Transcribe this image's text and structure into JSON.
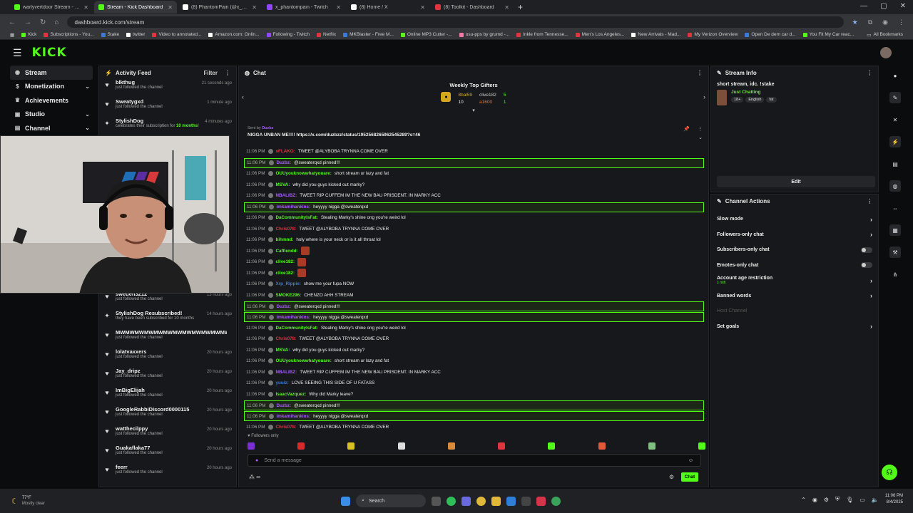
{
  "browser": {
    "tabs": [
      {
        "title": "warlyvertdoor Stream - Watch",
        "color": "#53fc18",
        "active": false
      },
      {
        "title": "Stream - Kick Dashboard",
        "color": "#53fc18",
        "active": true
      },
      {
        "title": "(8) PhantomPain (@x_Phantom...",
        "color": "#ffffff",
        "active": false
      },
      {
        "title": "x_phantompain - Twitch",
        "color": "#9146ff",
        "active": false
      },
      {
        "title": "(8) Home / X",
        "color": "#ffffff",
        "active": false
      },
      {
        "title": "(8) Toolkit - Dashboard",
        "color": "#e0343e",
        "active": false
      }
    ],
    "url": "dashboard.kick.com/stream",
    "bookmarks": [
      {
        "label": "Kick",
        "color": "#53fc18"
      },
      {
        "label": "Subscriptions - You...",
        "color": "#e0343e"
      },
      {
        "label": "Stake",
        "color": "#3a7bd5"
      },
      {
        "label": "twitter",
        "color": "#ffffff"
      },
      {
        "label": "Video to annotated...",
        "color": "#e0343e"
      },
      {
        "label": "Amazon.com: Onlin...",
        "color": "#ffffff"
      },
      {
        "label": "Following - Twitch",
        "color": "#9146ff"
      },
      {
        "label": "Netflix",
        "color": "#e0343e"
      },
      {
        "label": "MKBlaster - Free M...",
        "color": "#3a7bd5"
      },
      {
        "label": "Online MP3 Cutter -...",
        "color": "#53fc18"
      },
      {
        "label": "osu-pps by grumd -...",
        "color": "#f07aa5"
      },
      {
        "label": "Inkle from Tennesse...",
        "color": "#e0343e"
      },
      {
        "label": "Men's Los Angeles...",
        "color": "#e0343e"
      },
      {
        "label": "New Arrivals - Mad...",
        "color": "#ffffff"
      },
      {
        "label": "My Verizon Overview",
        "color": "#e0343e"
      },
      {
        "label": "Open De dem car d...",
        "color": "#3a7bd5"
      },
      {
        "label": "You Fit My Car reac...",
        "color": "#53fc18"
      }
    ],
    "all_bookmarks": "All Bookmarks"
  },
  "kick": {
    "logo": "KICK"
  },
  "nav": {
    "items": [
      {
        "label": "Stream",
        "icon": "stream-icon",
        "selected": true,
        "chevron": false
      },
      {
        "label": "Monetization",
        "icon": "dollar-icon",
        "selected": false,
        "chevron": true
      },
      {
        "label": "Achievements",
        "icon": "trophy-icon",
        "selected": false,
        "chevron": false
      },
      {
        "label": "Studio",
        "icon": "studio-icon",
        "selected": false,
        "chevron": true
      },
      {
        "label": "Channel",
        "icon": "channel-icon",
        "selected": false,
        "chevron": true
      }
    ]
  },
  "activity": {
    "title": "Activity Feed",
    "filter": "Filter",
    "items": [
      {
        "name": "blkthug",
        "sub": "just followed the channel",
        "time": "21 seconds ago",
        "icon": "heart"
      },
      {
        "name": "Sweatygxd",
        "sub": "just followed the channel",
        "time": "1 minute ago",
        "icon": "heart"
      },
      {
        "name": "StylishDog",
        "sub_pre": "celebrates their subscription for ",
        "sub_hl": "10 months",
        "sub_post": "!",
        "time": "4 minutes ago",
        "icon": "star"
      },
      {
        "name": "",
        "sub": "",
        "time": "",
        "icon": "none"
      },
      {
        "name": "",
        "sub": "",
        "time": "",
        "icon": "none"
      },
      {
        "name": "",
        "sub": "",
        "time": "",
        "icon": "none"
      },
      {
        "name": "",
        "sub": "",
        "time": "",
        "icon": "none"
      },
      {
        "name": "",
        "sub": "",
        "time": "",
        "icon": "none"
      },
      {
        "name": "",
        "sub": "",
        "time": "",
        "icon": "none"
      },
      {
        "name": "",
        "sub": "",
        "time": "",
        "icon": "none"
      },
      {
        "name": "",
        "sub": "",
        "time": "",
        "icon": "none"
      },
      {
        "name": "sweden3212",
        "sub": "just followed the channel",
        "time": "13 hours ago",
        "icon": "heart"
      },
      {
        "name": "StylishDog Resubscribed!",
        "sub": "they have been subscribed for 10 months",
        "time": "14 hours ago",
        "icon": "star"
      },
      {
        "name": "MWMWMWMWMWMWMWMWMWMWMWMW",
        "sub": "just followed the channel",
        "time": "",
        "icon": "heart"
      },
      {
        "name": "lolatvaxxers",
        "sub": "just followed the channel",
        "time": "20 hours ago",
        "icon": "heart"
      },
      {
        "name": "Jay_dripz",
        "sub": "just followed the channel",
        "time": "20 hours ago",
        "icon": "heart"
      },
      {
        "name": "ImBigElijah",
        "sub": "just followed the channel",
        "time": "20 hours ago",
        "icon": "heart"
      },
      {
        "name": "GoogleRabbiDiscord0000115",
        "sub": "just followed the channel",
        "time": "20 hours ago",
        "icon": "heart"
      },
      {
        "name": "watthecilppy",
        "sub": "just followed the channel",
        "time": "20 hours ago",
        "icon": "heart"
      },
      {
        "name": "Guakaflaka77",
        "sub": "just followed the channel",
        "time": "20 hours ago",
        "icon": "heart"
      },
      {
        "name": "feerr",
        "sub": "just followed the channel",
        "time": "20 hours ago",
        "icon": "heart"
      }
    ]
  },
  "chat": {
    "title": "Chat",
    "gifters_title": "Weekly Top Gifters",
    "gifters": [
      {
        "name": "8bal59",
        "count": "10",
        "name_color": "#d7a621"
      },
      {
        "name": "clive182",
        "count": "5",
        "name_color": "#cccccc"
      },
      {
        "name": "a1600",
        "count": "1",
        "name_color": "#e07a3a"
      }
    ],
    "pinned_by_pre": "Sent by ",
    "pinned_by_user": "Duzbz",
    "pinned_msg": "NIGGA UNBAN ME!!!! https://x.com/duzbzz/status/1952568265962545289?s=46",
    "lines": [
      {
        "time": "11:06 PM",
        "user": "xFLAKO",
        "ucolor": "#e0343e",
        "msg": "TWEET @ALYBOBA TRYNNA COME OVER",
        "hl": false
      },
      {
        "time": "11:06 PM",
        "user": "Duzbz",
        "ucolor": "#a85bff",
        "msg": "@sweaterqxd pinned!!!",
        "hl": true
      },
      {
        "time": "11:06 PM",
        "user": "OUUyouknowwhatyouare",
        "ucolor": "#53fc18",
        "msg": "short stream ur lazy and fat",
        "hl": false
      },
      {
        "time": "11:06 PM",
        "user": "MSVA",
        "ucolor": "#53fc18",
        "msg": "why did you guys kicked out marky?",
        "hl": false
      },
      {
        "time": "11:06 PM",
        "user": "NBALIBZ",
        "ucolor": "#a85bff",
        "msg": "TWEET RIP CUFFEM IM THE NEW BAU PRISDENT. IN MARKY ACC",
        "hl": false
      },
      {
        "time": "11:06 PM",
        "user": "imkamihankins",
        "ucolor": "#a85bff",
        "msg": "heyyyy nigga @sweaterqxd",
        "hl": true
      },
      {
        "time": "11:06 PM",
        "user": "DaCommunityIsFat",
        "ucolor": "#53fc18",
        "msg": "Stealing Marky's shine ong you're weird lol",
        "hl": false
      },
      {
        "time": "11:06 PM",
        "user": "Chris078",
        "ucolor": "#e0343e",
        "msg": "TWEET @ALYBOBA TRYNNA COME OVER",
        "hl": false
      },
      {
        "time": "11:06 PM",
        "user": "bihmnd",
        "ucolor": "#53fc18",
        "msg": "holy where is your neck or is it all throat lol",
        "hl": false
      },
      {
        "time": "11:06 PM",
        "user": "Caffiendd",
        "ucolor": "#53fc18",
        "msg": "",
        "emote": true,
        "hl": false
      },
      {
        "time": "11:06 PM",
        "user": "clive182",
        "ucolor": "#53fc18",
        "msg": "",
        "emote": true,
        "hl": false
      },
      {
        "time": "11:06 PM",
        "user": "clive182",
        "ucolor": "#53fc18",
        "msg": "",
        "emote": true,
        "hl": false
      },
      {
        "time": "11:06 PM",
        "user": "Xrp_Rippie",
        "ucolor": "#3a7bd5",
        "msg": "show me your fupa NOW",
        "hl": false
      },
      {
        "time": "11:06 PM",
        "user": "SMOKE296",
        "ucolor": "#53fc18",
        "msg": "CHENZO AHH STREAM",
        "hl": false
      },
      {
        "time": "11:06 PM",
        "user": "Duzbz",
        "ucolor": "#a85bff",
        "msg": "@sweaterqxd pinned!!!",
        "hl": true
      },
      {
        "time": "11:06 PM",
        "user": "imkamihankins",
        "ucolor": "#a85bff",
        "msg": "heyyyy nigga @sweaterqxd",
        "hl": true
      },
      {
        "time": "11:06 PM",
        "user": "DaCommunityIsFat",
        "ucolor": "#53fc18",
        "msg": "Stealing Marky's shine ong you're weird lol",
        "hl": false
      },
      {
        "time": "11:06 PM",
        "user": "Chris078",
        "ucolor": "#e0343e",
        "msg": "TWEET @ALYBOBA TRYNNA COME OVER",
        "hl": false
      },
      {
        "time": "11:06 PM",
        "user": "MSVA",
        "ucolor": "#53fc18",
        "msg": "why did you guys kicked out marky?",
        "hl": false
      },
      {
        "time": "11:06 PM",
        "user": "OUUyouknowwhatyouare",
        "ucolor": "#53fc18",
        "msg": "short stream ur lazy and fat",
        "hl": false
      },
      {
        "time": "11:06 PM",
        "user": "NBALIBZ",
        "ucolor": "#a85bff",
        "msg": "TWEET RIP CUFFEM IM THE NEW BAU PRISDENT. IN MARKY ACC",
        "hl": false
      },
      {
        "time": "11:06 PM",
        "user": "yuuiz",
        "ucolor": "#3a7bd5",
        "msg": "LOVE SEEING THIS SIDE OF U FATASS",
        "hl": false
      },
      {
        "time": "11:06 PM",
        "user": "IsaacVazquez",
        "ucolor": "#53fc18",
        "msg": "Why did Marky leave?",
        "hl": false
      },
      {
        "time": "11:06 PM",
        "user": "Duzbz",
        "ucolor": "#a85bff",
        "msg": "@sweaterqxd pinned!!!",
        "hl": true
      },
      {
        "time": "11:06 PM",
        "user": "imkamihankins",
        "ucolor": "#a85bff",
        "msg": "heyyyy nigga @sweaterqxd",
        "hl": true
      },
      {
        "time": "11:06 PM",
        "user": "Chris078",
        "ucolor": "#e0343e",
        "msg": "TWEET @ALYBOBA TRYNNA COME OVER",
        "hl": false
      }
    ],
    "followers_only": "Followers only",
    "emote_colors": [
      "#7b2fd6",
      "#d42b2b",
      "#d7c021",
      "#dddddd",
      "#d98b3a",
      "#e0343e",
      "#53fc18",
      "#e05a3a",
      "#7fbf7f",
      "#53fc18"
    ],
    "placeholder": "Send a message",
    "send_label": "Chat"
  },
  "stream_info": {
    "title": "Stream Info",
    "stream_title": "short stream, idc. !stake",
    "category": "Just Chatting",
    "tags": [
      "18+",
      "English",
      "fat"
    ],
    "edit_label": "Edit"
  },
  "channel_actions": {
    "title": "Channel Actions",
    "items": [
      {
        "label": "Slow mode",
        "kind": "chevron"
      },
      {
        "label": "Followers-only chat",
        "kind": "chevron"
      },
      {
        "label": "Subscribers-only chat",
        "kind": "toggle"
      },
      {
        "label": "Emotes-only chat",
        "kind": "toggle"
      },
      {
        "label": "Account age restriction",
        "kind": "chevron",
        "sub": "1 mth"
      },
      {
        "label": "Banned words",
        "kind": "chevron"
      },
      {
        "label": "Host Channel",
        "kind": "disabled"
      },
      {
        "label": "Set goals",
        "kind": "chevron"
      }
    ]
  },
  "taskbar": {
    "temp": "77°F",
    "weather": "Mostly clear",
    "search": "Search",
    "time": "11:06 PM",
    "date": "8/4/2025"
  }
}
